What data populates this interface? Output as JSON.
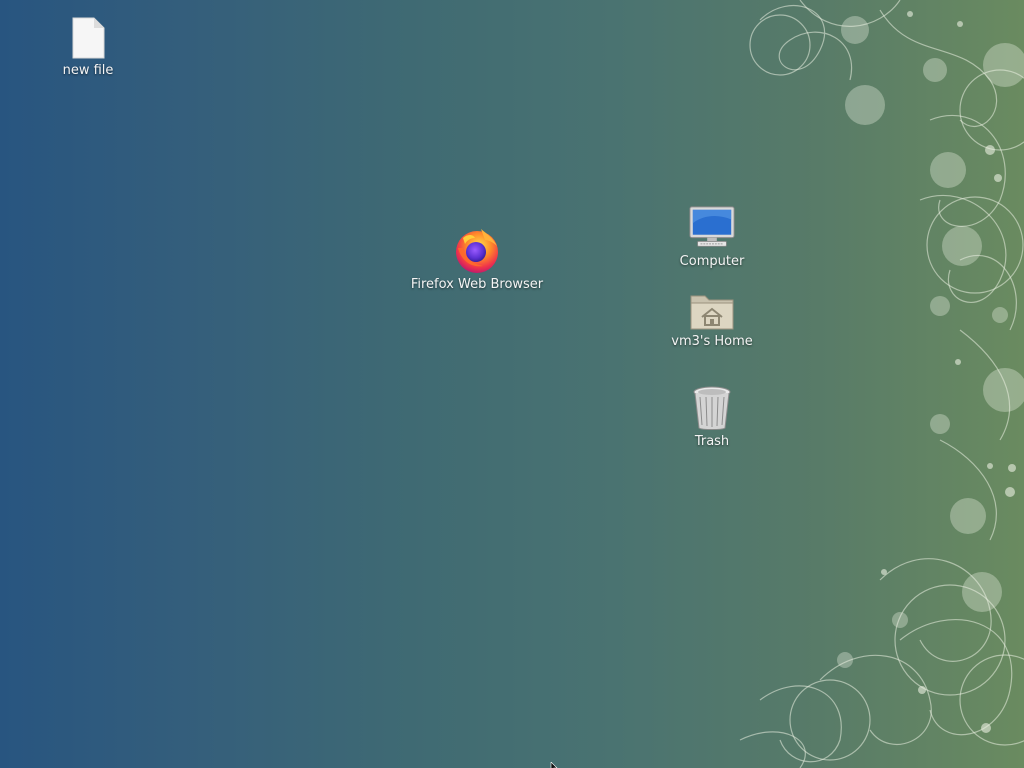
{
  "desktop": {
    "icons": [
      {
        "id": "new-file",
        "label": "new file",
        "icon": "text-file-icon"
      },
      {
        "id": "firefox",
        "label": "Firefox Web Browser",
        "icon": "firefox-icon"
      },
      {
        "id": "computer",
        "label": "Computer",
        "icon": "computer-icon"
      },
      {
        "id": "home",
        "label": "vm3's Home",
        "icon": "home-folder-icon"
      },
      {
        "id": "trash",
        "label": "Trash",
        "icon": "trash-icon"
      }
    ]
  },
  "colors": {
    "wallpaper_left": "#285580",
    "wallpaper_right": "#6a8b60",
    "label_text": "#f4f4f4"
  }
}
